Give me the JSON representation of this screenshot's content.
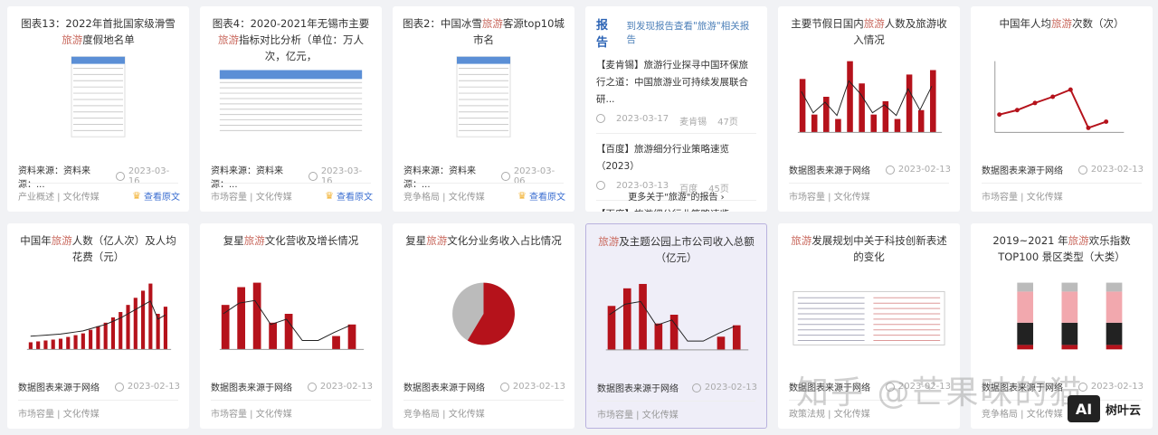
{
  "cards": [
    {
      "title_pre": "图表13：2022年首批国家级滑雪",
      "title_kw": "旅游",
      "title_post": "度假地名单",
      "source": "资料来源：资料来源：...",
      "date": "2023-03-16",
      "tags": "产业概述 | 文化传媒",
      "view": "查看原文"
    },
    {
      "title_pre": "图表4：2020-2021年无锡市主要",
      "title_kw": "旅游",
      "title_post": "指标对比分析（单位：万人次，亿元，",
      "source": "资料来源：资料来源：...",
      "date": "2023-03-16",
      "tags": "市场容量 | 文化传媒",
      "view": "查看原文"
    },
    {
      "title_pre": "图表2：中国冰雪",
      "title_kw": "旅游",
      "title_post": "客源top10城市名",
      "source": "资料来源：资料来源：...",
      "date": "2023-03-06",
      "tags": "竞争格局 | 文化传媒",
      "view": "查看原文"
    },
    {
      "title_pre": "主要节假日国内",
      "title_kw": "旅游",
      "title_post": "人数及旅游收入情况",
      "source": "数据图表来源于网络",
      "date": "2023-02-13",
      "tags": "市场容量 | 文化传媒"
    },
    {
      "title_pre": "中国年人均",
      "title_kw": "旅游",
      "title_post": "次数（次）",
      "source": "数据图表来源于网络",
      "date": "2023-02-13",
      "tags": "市场容量 | 文化传媒"
    },
    {
      "title_pre": "中国年",
      "title_kw": "旅游",
      "title_post": "人数（亿人次）及人均花费（元）",
      "source": "数据图表来源于网络",
      "date": "2023-02-13",
      "tags": "市场容量 | 文化传媒"
    },
    {
      "title_pre": "复星",
      "title_kw": "旅游",
      "title_post": "文化营收及增长情况",
      "source": "数据图表来源于网络",
      "date": "2023-02-13",
      "tags": "市场容量 | 文化传媒"
    },
    {
      "title_pre": "复星",
      "title_kw": "旅游",
      "title_post": "文化分业务收入占比情况",
      "source": "数据图表来源于网络",
      "date": "2023-02-13",
      "tags": "竞争格局 | 文化传媒"
    },
    {
      "title_pre": "",
      "title_kw": "旅游",
      "title_post": "及主题公园上市公司收入总额（亿元）",
      "source": "数据图表来源于网络",
      "date": "2023-02-13",
      "tags": "市场容量 | 文化传媒"
    },
    {
      "title_pre": "",
      "title_kw": "旅游",
      "title_post": "发展规划中关于科技创新表述的变化",
      "source": "数据图表来源于网络",
      "date": "2023-02-13",
      "tags": "政策法规 | 文化传媒"
    },
    {
      "title_pre": "2019~2021 年",
      "title_kw": "旅游",
      "title_post": "欢乐指数 TOP100 景区类型（大类）",
      "source": "数据图表来源于网络",
      "date": "2023-02-13",
      "tags": "竞争格局 | 文化传媒"
    }
  ],
  "report": {
    "logo": "报告",
    "head": "到发现报告查看\"旅游\"相关报告",
    "items": [
      {
        "title": "【麦肯锡】旅游行业探寻中国环保旅行之道：中国旅游业可持续发展联合研...",
        "date": "2023-03-17",
        "author": "麦肯锡",
        "pages": "47页"
      },
      {
        "title": "【百度】旅游细分行业策略速览（2023）",
        "date": "2023-03-13",
        "author": "百度",
        "pages": "45页"
      },
      {
        "title": "【百度】旅游细分行业策略速览"
      }
    ],
    "more": "更多关于\"旅游\"的报告 ›"
  },
  "watermark": "知乎 @芒果味的猫",
  "brand": {
    "logo": "AI",
    "name": "树叶云"
  },
  "colors": {
    "keyword": "#c9695e",
    "accent": "#3c6fd1",
    "chart_red": "#b5121b"
  }
}
